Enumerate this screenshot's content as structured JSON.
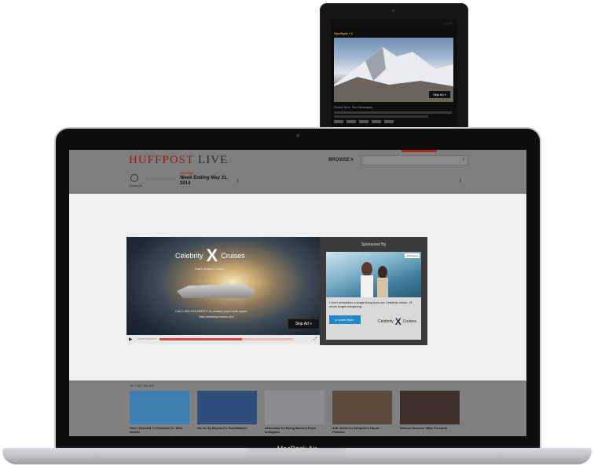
{
  "tablet": {
    "section_title": "Spotlight » 1",
    "skip_label": "Skip Ad »",
    "caption": "Grand Tour: The Himalayas"
  },
  "laptop": {
    "model_label": "MacBook Air"
  },
  "site": {
    "logo_primary": "HUFFPOST",
    "logo_secondary": "LIVE",
    "browse_label": "BROWSE ▾",
    "search_placeholder": "",
    "schedule_label": "Schedule",
    "full_schedule": "SCHEDULE LIVE",
    "on_now_label": "ON NOW",
    "on_now_title": "Week Ending May 31, 2014"
  },
  "ad_player": {
    "brand_left": "Celebrity",
    "brand_x": "X",
    "brand_right": "Cruises",
    "tagline": "That's Modern Luxury",
    "call_text": "Call 1-800-CELEBRITY or contact your travel agent",
    "url_text": "Visit celebritycruises.com",
    "skip_label": "Skip Ad »",
    "controls_label": "ADVERTISEMENT",
    "progress_fraction": 0.62
  },
  "sponsor": {
    "label": "Sponsored By",
    "badge": "AdChoices",
    "text": "I don't remember a single thing from our Celebrity cruise. I'll never forget everything.",
    "button_label": "▸ Learn More",
    "logo_left": "Celebrity",
    "logo_x": "X",
    "logo_right": "Cruises"
  },
  "news": {
    "header": "IN THE NEWS",
    "items": [
      {
        "caption": "How I Decided To Embrace Dr. Who Neville",
        "thumb": "#3e7fb1"
      },
      {
        "caption": "Ne-Yo On Beyoncé's Surveillance",
        "thumb": "#2f4f7a"
      },
      {
        "caption": "Artcurafts On Being Banned From Instagram",
        "thumb": "#8a8d91"
      },
      {
        "caption": "A.B. Scott On DiCaprio's House Pictures",
        "thumb": "#5b4a3e"
      },
      {
        "caption": "Women Discuss Talks Personal",
        "thumb": "#3d2f2a"
      }
    ]
  }
}
